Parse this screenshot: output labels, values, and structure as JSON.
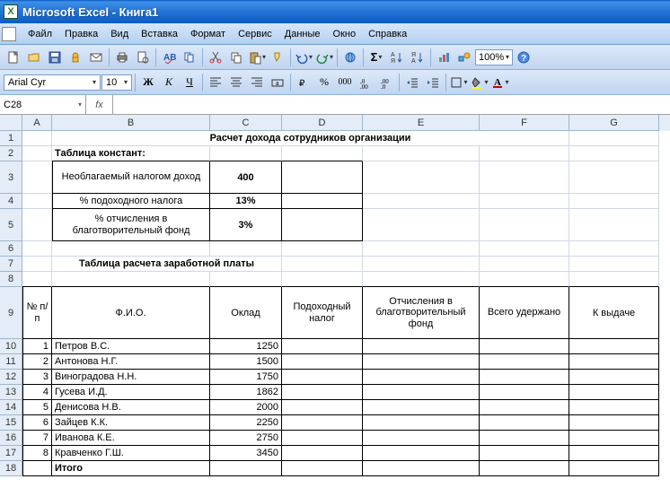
{
  "title": "Microsoft Excel - Книга1",
  "excel_icon": "X",
  "menu": {
    "file": "Файл",
    "edit": "Правка",
    "view": "Вид",
    "insert": "Вставка",
    "format": "Формат",
    "tools": "Сервис",
    "data": "Данные",
    "window": "Окно",
    "help": "Справка"
  },
  "toolbar": {
    "zoom": "100%"
  },
  "format": {
    "font": "Arial Cyr",
    "size": "10"
  },
  "name_box": "C28",
  "fx": "fx",
  "columns": [
    "A",
    "B",
    "C",
    "D",
    "E",
    "F",
    "G"
  ],
  "sheet": {
    "title": "Расчет дохода сотрудников организации",
    "const_header": "Таблица констант:",
    "const_rows": [
      {
        "label": "Необлагаемый налогом доход",
        "value": "400"
      },
      {
        "label": "% подоходного налога",
        "value": "13%"
      },
      {
        "label": "% отчисления в благотворительный фонд",
        "value": "3%"
      }
    ],
    "calc_header": "Таблица расчета заработной платы",
    "headers": {
      "no": "№\nп/п",
      "fio": "Ф.И.О.",
      "oklad": "Оклад",
      "tax": "Подоходный налог",
      "charity": "Отчисления в благотворительный фонд",
      "withheld": "Всего удержано",
      "pay": "К выдаче"
    },
    "rows": [
      {
        "n": "1",
        "fio": "Петров В.С.",
        "oklad": "1250"
      },
      {
        "n": "2",
        "fio": "Антонова Н.Г.",
        "oklad": "1500"
      },
      {
        "n": "3",
        "fio": "Виноградова Н.Н.",
        "oklad": "1750"
      },
      {
        "n": "4",
        "fio": "Гусева И.Д.",
        "oklad": "1862"
      },
      {
        "n": "5",
        "fio": "Денисова Н.В.",
        "oklad": "2000"
      },
      {
        "n": "6",
        "fio": "Зайцев К.К.",
        "oklad": "2250"
      },
      {
        "n": "7",
        "fio": "Иванова К.Е.",
        "oklad": "2750"
      },
      {
        "n": "8",
        "fio": "Кравченко Г.Ш.",
        "oklad": "3450"
      }
    ],
    "total": "Итого"
  }
}
